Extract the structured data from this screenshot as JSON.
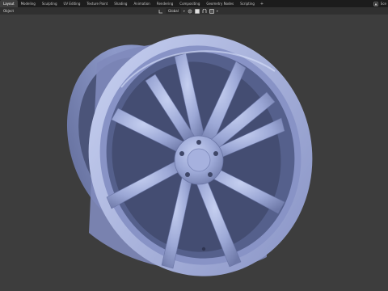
{
  "workspace_tabs": [
    {
      "label": "Layout"
    },
    {
      "label": "Modeling"
    },
    {
      "label": "Sculpting"
    },
    {
      "label": "UV Editing"
    },
    {
      "label": "Texture Paint"
    },
    {
      "label": "Shading"
    },
    {
      "label": "Animation"
    },
    {
      "label": "Rendering"
    },
    {
      "label": "Compositing"
    },
    {
      "label": "Geometry Nodes"
    },
    {
      "label": "Scripting"
    }
  ],
  "active_tab": "Layout",
  "add_tab": "+",
  "scene": {
    "label": "Sce"
  },
  "header": {
    "mode": "Object",
    "transform_orientation": "Global"
  },
  "viewport": {
    "object": "wheel-rim",
    "colors": {
      "background": "#3d3d3d",
      "rim_light": "#b4c0e6",
      "rim_mid": "#8e9acc",
      "rim_dark": "#5f6a98"
    }
  }
}
